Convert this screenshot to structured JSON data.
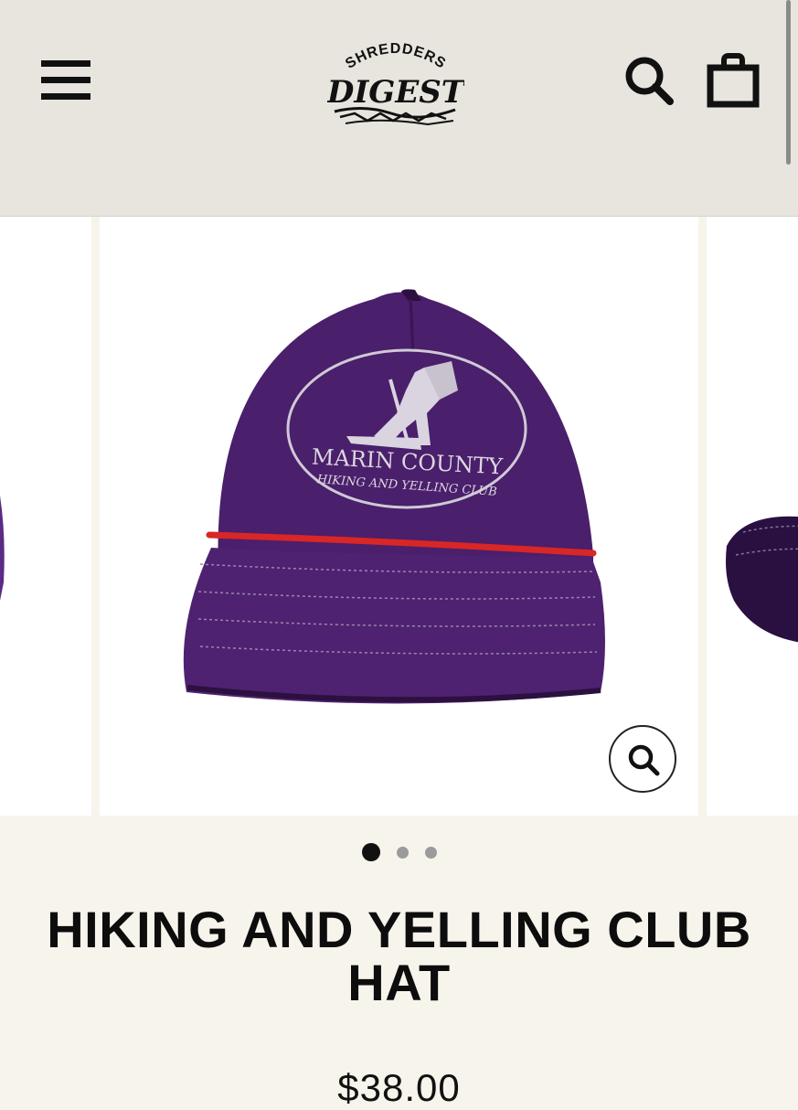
{
  "header": {
    "menu_icon": "hamburger-icon",
    "logo_text_top": "SHREDDERS",
    "logo_text_main": "DIGEST",
    "search_icon": "search-icon",
    "cart_icon": "shopping-bag-icon"
  },
  "product": {
    "title": "HIKING AND YELLING CLUB HAT",
    "price": "$38.00",
    "hat_patch_line1": "MARIN COUNTY",
    "hat_patch_line2": "HIKING AND YELLING CLUB",
    "hat_color": "#4a1f6b",
    "rope_color": "#d92626"
  },
  "gallery": {
    "zoom_icon": "zoom-icon",
    "slide_count": 3,
    "active_slide": 1
  }
}
